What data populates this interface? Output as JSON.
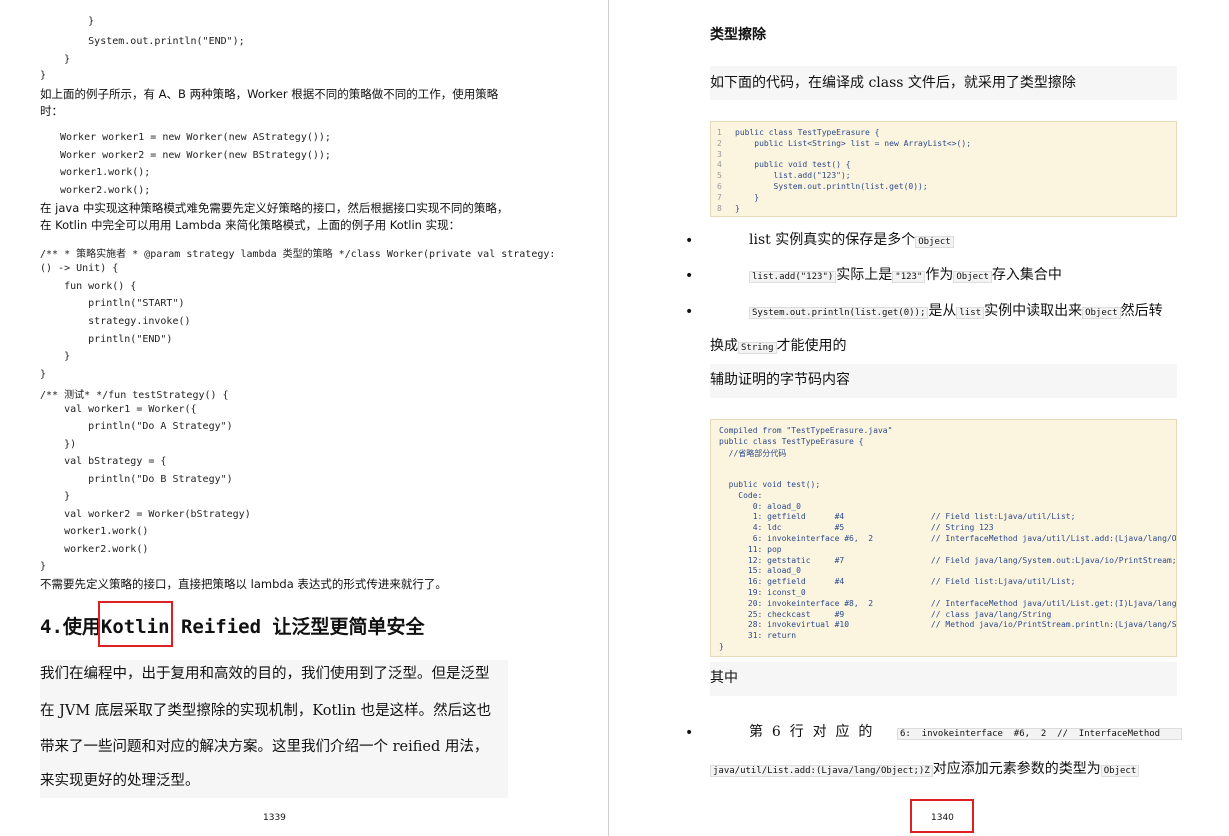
{
  "left_page": {
    "code_top": [
      "        }",
      "        System.out.println(\"END\");",
      "    }",
      "}"
    ],
    "para1_line1": "如上面的例子所示，有 A、B 两种策略，Worker 根据不同的策略做不同的工作，使用策略",
    "para1_line2": "时：",
    "code_mid": [
      "Worker worker1 = new Worker(new AStrategy());",
      "Worker worker2 = new Worker(new BStrategy());",
      "worker1.work();",
      "worker2.work();"
    ],
    "para2_line1": "在 java 中实现这种策略模式难免需要先定义好策略的接口，然后根据接口实现不同的策略，",
    "para2_line2": "在 Kotlin 中完全可以用用 Lambda 来简化策略模式，上面的例子用 Kotlin 实现：",
    "kotlin_code": [
      "/** * 策略实施者 * @param strategy lambda 类型的策略 */class Worker(private val strategy:",
      "() -> Unit) {",
      "    fun work() {",
      "        println(\"START\")",
      "        strategy.invoke()",
      "        println(\"END\")",
      "    }",
      "}",
      "/** 测试* */fun testStrategy() {",
      "    val worker1 = Worker({",
      "        println(\"Do A Strategy\")",
      "    })",
      "    val bStrategy = {",
      "        println(\"Do B Strategy\")",
      "    }",
      "    val worker2 = Worker(bStrategy)",
      "    worker1.work()",
      "    worker2.work()",
      "}"
    ],
    "para3": "不需要先定义策略的接口，直接把策略以 lambda 表达式的形式传进来就行了。",
    "heading": {
      "prefix": "4.使用",
      "boxed": "Kotlin",
      "suffix": " Reified 让泛型更简单安全"
    },
    "body_lines": [
      "我们在编程中，出于复用和高效的目的，我们使用到了泛型。但是泛型",
      "在 JVM 底层采取了类型擦除的实现机制，Kotlin 也是这样。然后这也",
      "带来了一些问题和对应的解决方案。这里我们介绍一个 reified 用法，",
      "来实现更好的处理泛型。"
    ],
    "page_number": "1339"
  },
  "right_page": {
    "section_title": "类型擦除",
    "intro": "如下面的代码，在编译成 class 文件后，就采用了类型擦除",
    "code1": [
      {
        "n": "1",
        "t": "public class TestTypeErasure {"
      },
      {
        "n": "2",
        "t": "    public List<String> list = new ArrayList<>();"
      },
      {
        "n": "3",
        "t": ""
      },
      {
        "n": "4",
        "t": "    public void test() {"
      },
      {
        "n": "5",
        "t": "        list.add(\"123\");"
      },
      {
        "n": "6",
        "t": "        System.out.println(list.get(0));"
      },
      {
        "n": "7",
        "t": "    }"
      },
      {
        "n": "8",
        "t": "}"
      }
    ],
    "b1_text": "list 实例真实的保存是多个",
    "b1_code": "Object",
    "b2_code1": "list.add(\"123\")",
    "b2_text1": "实际上是",
    "b2_code2": "\"123\"",
    "b2_text2": "作为",
    "b2_code3": "Object",
    "b2_text3": "存入集合中",
    "b3_code1": "System.out.println(list.get(0));",
    "b3_text1": "是从",
    "b3_code2": "list",
    "b3_text2": "实例中读取出来",
    "b3_code3": "Object",
    "b3_text3": "然后转",
    "b3_cont1": "换成",
    "b3_code4": "String",
    "b3_cont2": "才能使用的",
    "bytecode_title": "辅助证明的字节码内容",
    "code2": [
      "Compiled from \"TestTypeErasure.java\"",
      "public class TestTypeErasure {",
      "  //省略部分代码",
      "",
      "",
      "  public void test();",
      "    Code:",
      "       0: aload_0",
      "       1: getfield      #4                  // Field list:Ljava/util/List;",
      "       4: ldc           #5                  // String 123",
      "       6: invokeinterface #6,  2            // InterfaceMethod java/util/List.add:(Ljava/lang/Objec",
      "      11: pop",
      "      12: getstatic     #7                  // Field java/lang/System.out:Ljava/io/PrintStream;",
      "      15: aload_0",
      "      16: getfield      #4                  // Field list:Ljava/util/List;",
      "      19: iconst_0",
      "      20: invokeinterface #8,  2            // InterfaceMethod java/util/List.get:(I)Ljava/lang/Obj",
      "      25: checkcast     #9                  // class java/lang/String",
      "      28: invokevirtual #10                 // Method java/io/PrintStream.println:(Ljava/lang/Strin",
      "      31: return",
      "}"
    ],
    "among": "其中",
    "b4_text": "第  6  行  对  应  的",
    "b4_code": "6:  invokeinterface  #6,  2  //  InterfaceMethod",
    "b4_cont_code": "java/util/List.add:(Ljava/lang/Object;)Z",
    "b4_cont_text": "对应添加元素参数的类型为",
    "b4_cont_code2": "Object",
    "page_number": "1340"
  },
  "colors": {
    "highlight": "#e02020",
    "code_bg": "#fbf5e0",
    "keyword": "#c0392b"
  },
  "icons": {
    "bullet": "bullet-dot-icon"
  }
}
